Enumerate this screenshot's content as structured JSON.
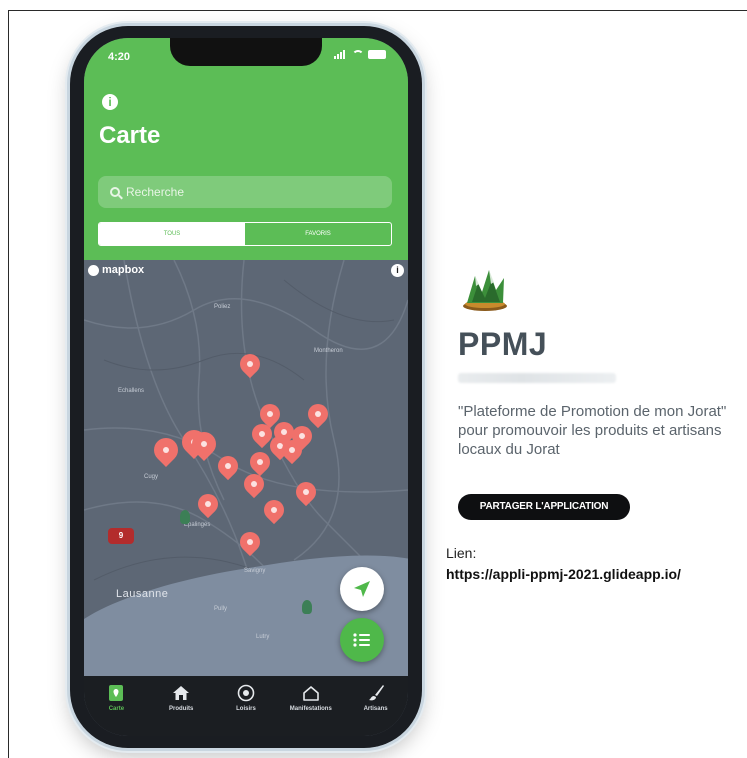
{
  "status": {
    "time": "4:20"
  },
  "header": {
    "title": "Carte",
    "search_placeholder": "Recherche",
    "segments": [
      "Tous",
      "Favoris"
    ]
  },
  "map": {
    "brand": "mapbox",
    "places": {
      "city": "Lausanne",
      "minor": [
        "Echallens",
        "Poliez",
        "Montheron",
        "Cugy",
        "Savigny",
        "Epalinges",
        "Pully",
        "Lutry"
      ]
    },
    "highway_badge": "9"
  },
  "tabs": [
    {
      "label": "Carte",
      "icon": "map-pin-square-icon",
      "active": true
    },
    {
      "label": "Produits",
      "icon": "home-icon",
      "active": false
    },
    {
      "label": "Loisirs",
      "icon": "camera-icon",
      "active": false
    },
    {
      "label": "Manifestations",
      "icon": "house-outline-icon",
      "active": false
    },
    {
      "label": "Artisans",
      "icon": "paintbrush-icon",
      "active": false
    }
  ],
  "app": {
    "name": "PPMJ",
    "description": "\"Plateforme de Promotion de mon Jorat\" pour promouvoir les produits et artisans locaux du Jorat",
    "share_label": "PARTAGER L'APPLICATION",
    "link_label": "Lien:",
    "link_url": "https://appli-ppmj-2021.glideapp.io/"
  },
  "colors": {
    "brand_green": "#5cbd56",
    "pin_red": "#f0716b",
    "tab_bar": "#1b1e22"
  }
}
